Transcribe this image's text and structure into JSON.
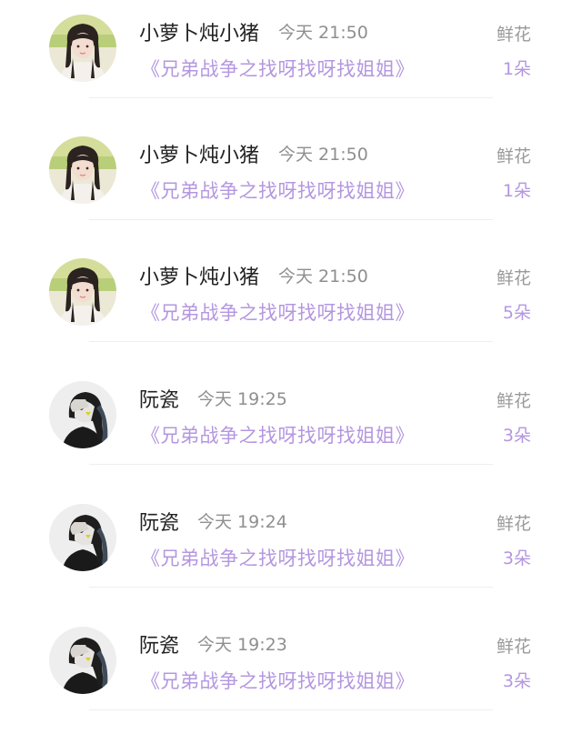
{
  "gifts": [
    {
      "user": "小萝卜炖小猪",
      "time": "今天 21:50",
      "book": "《兄弟战争之找呀找呀找姐姐》",
      "gift_type": "鲜花",
      "count": "1朵",
      "avatar_icon": "girl-photo-avatar"
    },
    {
      "user": "小萝卜炖小猪",
      "time": "今天 21:50",
      "book": "《兄弟战争之找呀找呀找姐姐》",
      "gift_type": "鲜花",
      "count": "1朵",
      "avatar_icon": "girl-photo-avatar"
    },
    {
      "user": "小萝卜炖小猪",
      "time": "今天 21:50",
      "book": "《兄弟战争之找呀找呀找姐姐》",
      "gift_type": "鲜花",
      "count": "5朵",
      "avatar_icon": "girl-photo-avatar"
    },
    {
      "user": "阮瓷",
      "time": "今天 19:25",
      "book": "《兄弟战争之找呀找呀找姐姐》",
      "gift_type": "鲜花",
      "count": "3朵",
      "avatar_icon": "dark-hair-avatar"
    },
    {
      "user": "阮瓷",
      "time": "今天 19:24",
      "book": "《兄弟战争之找呀找呀找姐姐》",
      "gift_type": "鲜花",
      "count": "3朵",
      "avatar_icon": "dark-hair-avatar"
    },
    {
      "user": "阮瓷",
      "time": "今天 19:23",
      "book": "《兄弟战争之找呀找呀找姐姐》",
      "gift_type": "鲜花",
      "count": "3朵",
      "avatar_icon": "dark-hair-avatar"
    }
  ],
  "colors": {
    "accent": "#b497e0",
    "name": "#222222",
    "muted": "#9a9a9a",
    "divider": "#eeeeee"
  }
}
